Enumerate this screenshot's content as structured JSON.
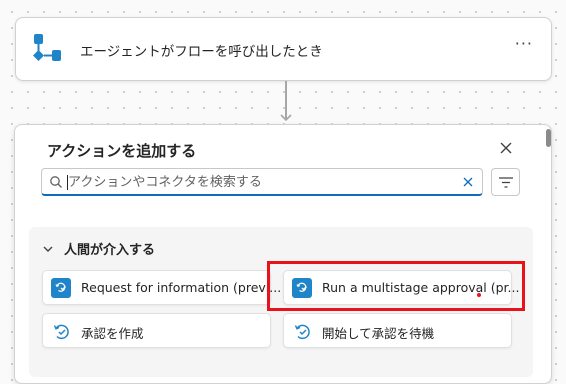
{
  "trigger": {
    "title": "エージェントがフローを呼び出したとき",
    "more_label": "···"
  },
  "panel": {
    "title": "アクションを追加する",
    "close_label": "close",
    "search": {
      "placeholder": "アクションやコネクタを検索する",
      "value": ""
    },
    "section": {
      "title": "人間が介入する",
      "actions": [
        {
          "label": "Request for information (previ...",
          "icon": "approval-connector-icon"
        },
        {
          "label": "Run a multistage approval (pr...",
          "icon": "approval-connector-icon"
        },
        {
          "label": "承認を作成",
          "icon": "approval-refresh-icon"
        },
        {
          "label": "開始して承認を待機",
          "icon": "approval-refresh-icon"
        }
      ]
    }
  },
  "colors": {
    "accent": "#0f6cbd",
    "connector_icon_bg": "#1f85c8",
    "highlight": "#e8131a"
  }
}
